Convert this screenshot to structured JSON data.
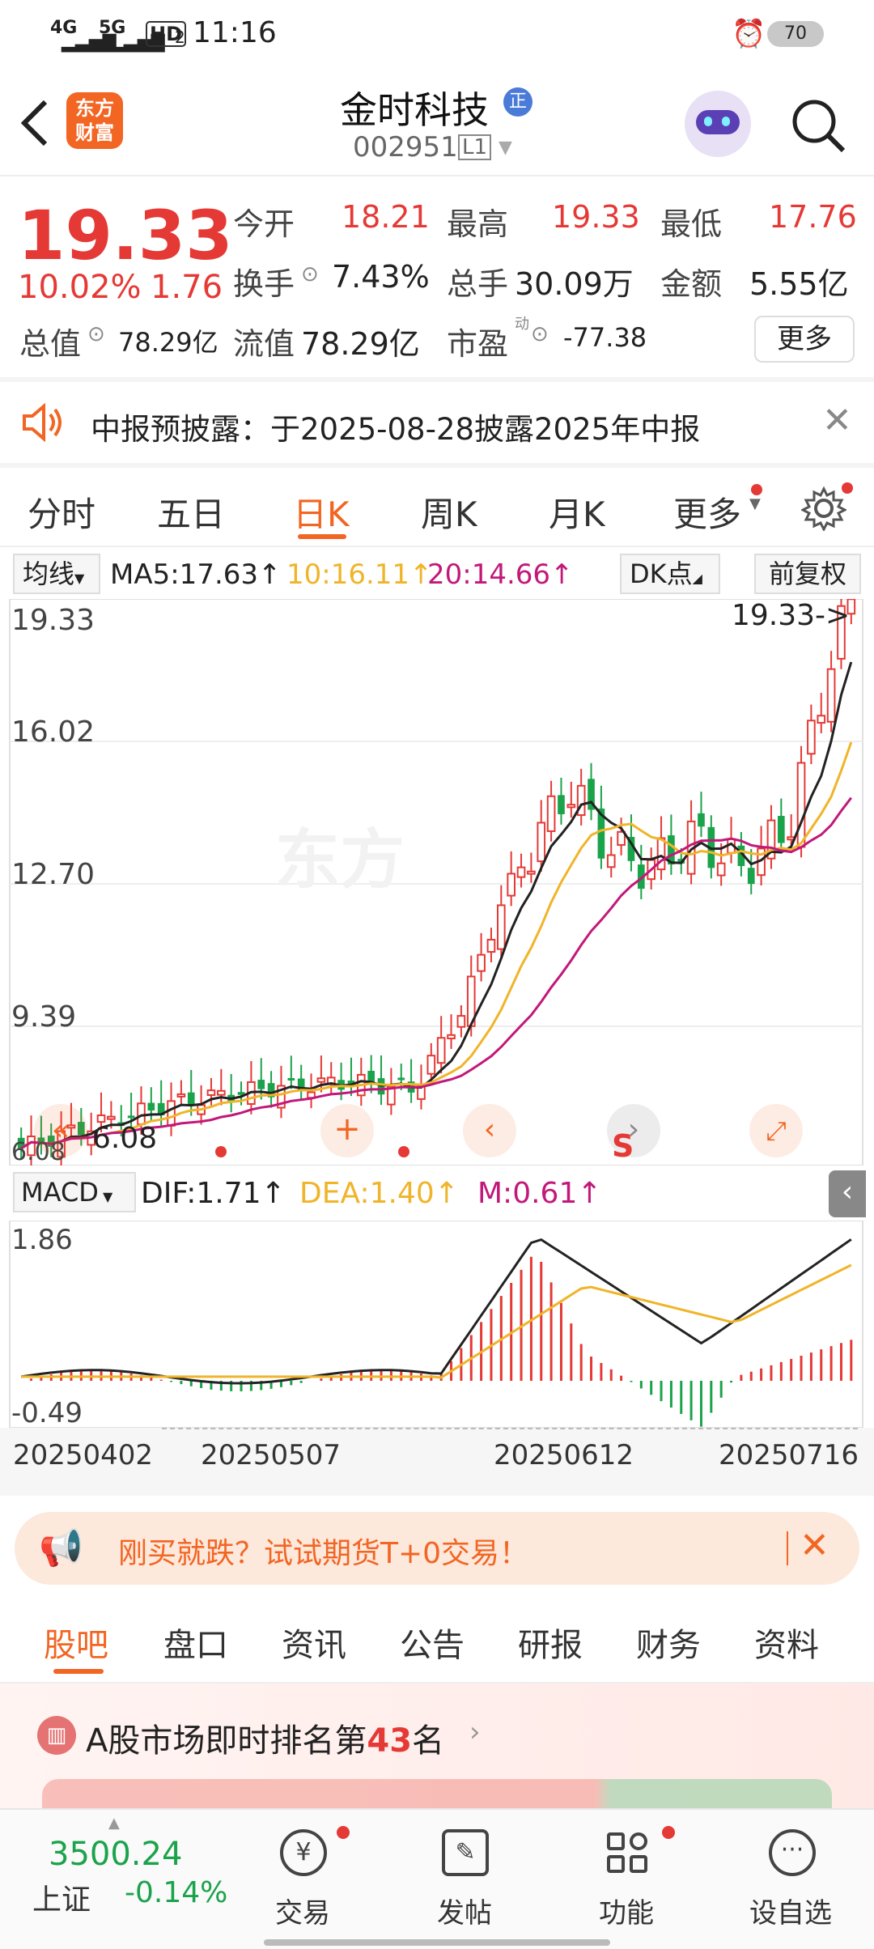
{
  "status": {
    "signal1": "4G",
    "signal2": "5G",
    "hd": "HD",
    "hd_sub": "2",
    "time": "11:16",
    "battery": "70"
  },
  "header": {
    "title": "金时科技",
    "title_badge": "正",
    "code": "002951",
    "level": "L1",
    "logo_text_top": "东方",
    "logo_text_bottom": "财富"
  },
  "quote": {
    "price": "19.33",
    "change_pct": "10.02%",
    "change": "1.76",
    "open_label": "今开",
    "open": "18.21",
    "high_label": "最高",
    "high": "19.33",
    "low_label": "最低",
    "low": "17.76",
    "turnover_label": "换手",
    "turnover": "7.43%",
    "volume_label": "总手",
    "volume": "30.09万",
    "amount_label": "金额",
    "amount": "5.55亿",
    "mcap_label": "总值",
    "mcap": "78.29亿",
    "float_label": "流值",
    "float": "78.29亿",
    "pe_label": "市盈",
    "pe_sup": "动",
    "pe": "-77.38",
    "more": "更多"
  },
  "notice": {
    "text": "中报预披露：于2025-08-28披露2025年中报"
  },
  "chart_tabs": [
    "分时",
    "五日",
    "日K",
    "周K",
    "月K",
    "更多"
  ],
  "active_tab": "日K",
  "ma_bar": {
    "selector": "均线",
    "ma5": "MA5:17.63↑",
    "ma10": "10:16.11↑",
    "ma20": "20:14.66↑",
    "dk": "DK点",
    "adjust": "前复权"
  },
  "kline_axis": {
    "y1": "19.33",
    "y2": "16.02",
    "y3": "12.70",
    "y4": "9.39",
    "y5": "6.08",
    "high_mark": "19.33->",
    "low_mark": "6.08"
  },
  "macd_bar": {
    "selector": "MACD",
    "dif": "DIF:1.71↑",
    "dea": "DEA:1.40↑",
    "m": "M:0.61↑"
  },
  "macd_axis": {
    "top": "1.86",
    "bottom": "-0.49"
  },
  "dates": [
    "20250402",
    "20250507",
    "20250612",
    "20250716"
  ],
  "kline_s_mark": "S",
  "ad": {
    "text": "刚买就跌？试试期货T+0交易！"
  },
  "sub_tabs": [
    "股吧",
    "盘口",
    "资讯",
    "公告",
    "研报",
    "财务",
    "资料"
  ],
  "active_sub_tab": "股吧",
  "rank": {
    "prefix": "A股市场即时排名第",
    "num": "43",
    "suffix": "名"
  },
  "bottom": {
    "index_value": "3500.24",
    "index_name": "上证",
    "index_change": "-0.14%",
    "nav": [
      {
        "label": "交易"
      },
      {
        "label": "发帖"
      },
      {
        "label": "功能"
      },
      {
        "label": "设自选"
      }
    ]
  },
  "colors": {
    "up": "#e53935",
    "down": "#1aa34a",
    "ma5": "#222222",
    "ma10": "#f0b429",
    "ma20": "#c2187a",
    "accent": "#f26522"
  },
  "chart_data": {
    "type": "candlestick",
    "y_axis_ticks": [
      19.33,
      16.02,
      12.7,
      9.39,
      6.08
    ],
    "x_axis_ticks": [
      "20250402",
      "20250507",
      "20250612",
      "20250716"
    ],
    "ma": {
      "MA5": 17.63,
      "MA10": 16.11,
      "MA20": 14.66
    },
    "macd": {
      "DIF": 1.71,
      "DEA": 1.4,
      "M": 0.61,
      "ylim": [
        -0.49,
        1.86
      ]
    }
  }
}
